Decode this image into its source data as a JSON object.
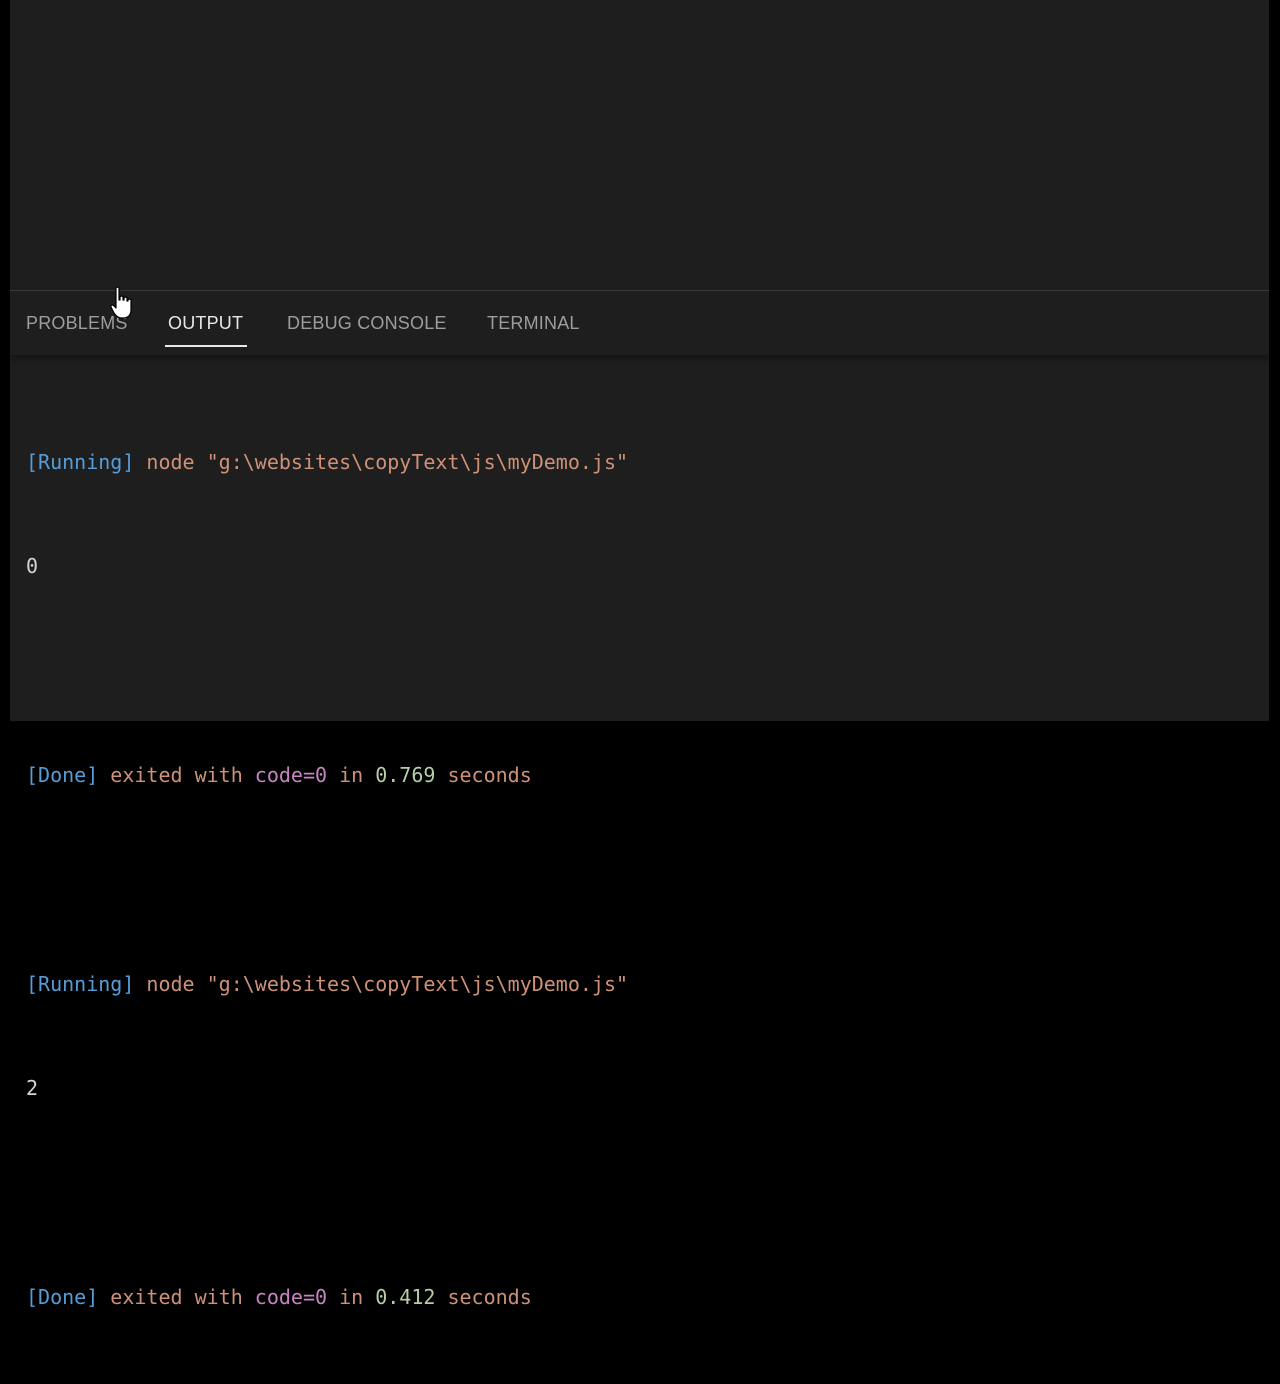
{
  "panel": {
    "tabs": [
      {
        "label": "PROBLEMS",
        "active": false
      },
      {
        "label": "OUTPUT",
        "active": true
      },
      {
        "label": "DEBUG CONSOLE",
        "active": false
      },
      {
        "label": "TERMINAL",
        "active": false
      }
    ]
  },
  "output": {
    "runs": [
      {
        "running_tag": "[Running]",
        "command": " node \"g:\\websites\\copyText\\js\\myDemo.js\"",
        "result": "0",
        "done_tag": "[Done]",
        "exited_text": " exited with ",
        "code_text": "code=0",
        "in_text": " in ",
        "duration": "0.769",
        "seconds_text": " seconds"
      },
      {
        "running_tag": "[Running]",
        "command": " node \"g:\\websites\\copyText\\js\\myDemo.js\"",
        "result": "2",
        "done_tag": "[Done]",
        "exited_text": " exited with ",
        "code_text": "code=0",
        "in_text": " in ",
        "duration": "0.412",
        "seconds_text": " seconds"
      }
    ]
  },
  "colors": {
    "background": "#1e1e1e",
    "tag": "#569cd6",
    "string": "#ce9178",
    "code": "#c586c0",
    "number": "#b5cea8",
    "tab_active": "#e7e7e7",
    "tab_inactive": "#9d9d9d"
  },
  "cursor": {
    "icon": "hand-pointer-icon"
  }
}
